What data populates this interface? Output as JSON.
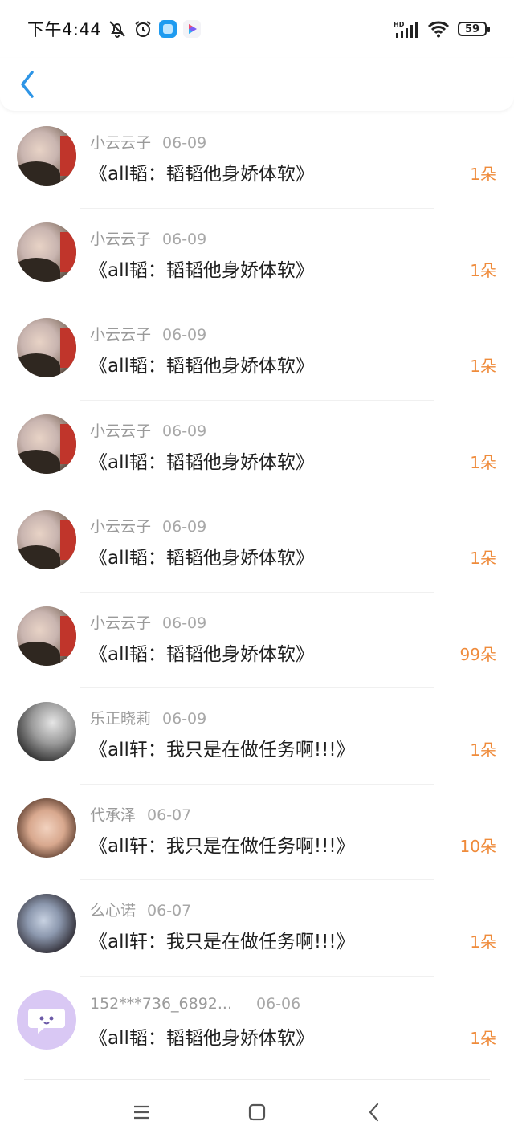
{
  "status_bar": {
    "time": "下午4:44",
    "network": "HD",
    "battery": "59"
  },
  "header": {
    "back_icon": "chevron-left-icon"
  },
  "items": [
    {
      "user": "小云云子",
      "date": "06-09",
      "title": "《all韬：韬韬他身娇体软》",
      "count": "1朵",
      "avatar": "sky"
    },
    {
      "user": "小云云子",
      "date": "06-09",
      "title": "《all韬：韬韬他身娇体软》",
      "count": "1朵",
      "avatar": "sky"
    },
    {
      "user": "小云云子",
      "date": "06-09",
      "title": "《all韬：韬韬他身娇体软》",
      "count": "1朵",
      "avatar": "sky"
    },
    {
      "user": "小云云子",
      "date": "06-09",
      "title": "《all韬：韬韬他身娇体软》",
      "count": "1朵",
      "avatar": "sky"
    },
    {
      "user": "小云云子",
      "date": "06-09",
      "title": "《all韬：韬韬他身娇体软》",
      "count": "1朵",
      "avatar": "sky"
    },
    {
      "user": "小云云子",
      "date": "06-09",
      "title": "《all韬：韬韬他身娇体软》",
      "count": "99朵",
      "avatar": "sky"
    },
    {
      "user": "乐正晓莉",
      "date": "06-09",
      "title": "《all轩：我只是在做任务啊!!!》",
      "count": "1朵",
      "avatar": "cat"
    },
    {
      "user": "代承泽",
      "date": "06-07",
      "title": "《all轩：我只是在做任务啊!!!》",
      "count": "10朵",
      "avatar": "face"
    },
    {
      "user": "么心诺",
      "date": "06-07",
      "title": "《all轩：我只是在做任务啊!!!》",
      "count": "1朵",
      "avatar": "boy"
    },
    {
      "user": "152***736_6892...",
      "date": "06-06",
      "title": "《all韬：韬韬他身娇体软》",
      "count": "1朵",
      "avatar": "default"
    }
  ],
  "colors": {
    "accent": "#2e95e6",
    "count": "#ef8b3b",
    "meta": "#9a9a9a"
  },
  "nav": {
    "menu_icon": "menu-icon",
    "home_icon": "home-square-icon",
    "back_icon": "back-triangle-icon"
  }
}
